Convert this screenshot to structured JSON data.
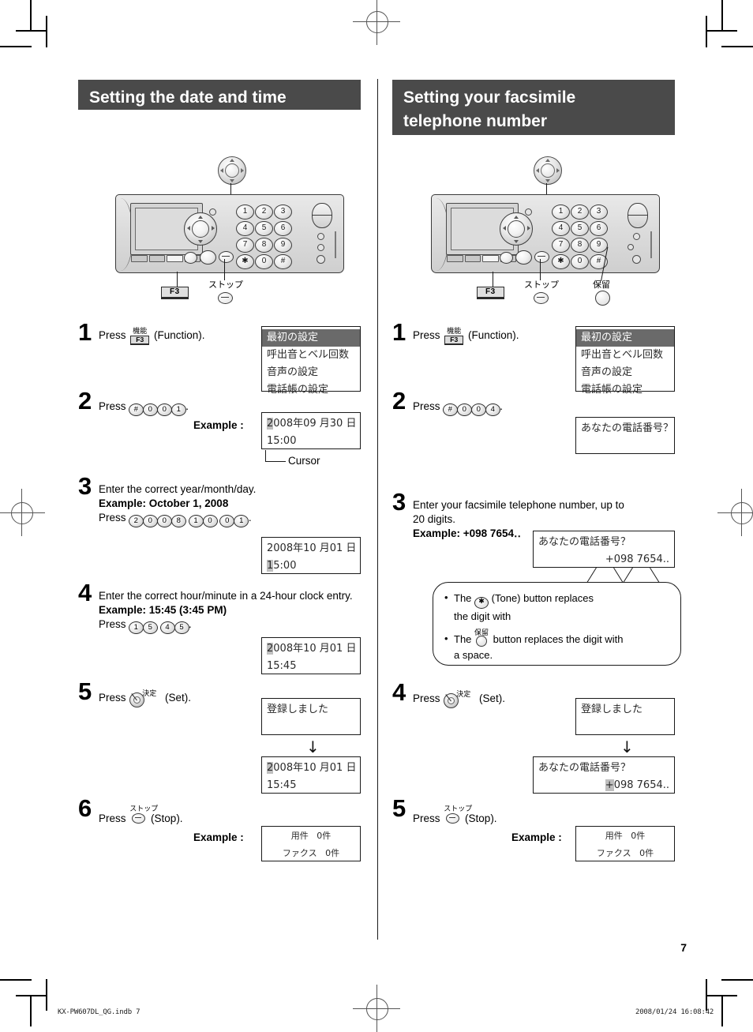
{
  "page_number": "7",
  "footer": {
    "left": "KX-PW607DL_QG.indb    7",
    "right": "2008/01/24    16:08:42"
  },
  "left_section": {
    "title": "Setting the date and time",
    "illustration": {
      "f3_label": "F3",
      "stop_label": "ストップ",
      "keys": [
        "1",
        "2",
        "3",
        "4",
        "5",
        "6",
        "7",
        "8",
        "9",
        "✱",
        "0",
        "#"
      ]
    },
    "steps": [
      {
        "num": "1",
        "press_prefix": "Press",
        "button_cap": "機能",
        "button_f3": "F3",
        "press_suffix": "(Function).",
        "lcd": {
          "selected": "最初の設定",
          "rows": [
            "呼出音とベル回数",
            "音声の設定",
            "電話帳の設定"
          ]
        }
      },
      {
        "num": "2",
        "press_prefix": "Press",
        "keys": [
          "#",
          "0",
          "0",
          "1"
        ],
        "press_suffix": ".",
        "example_label": "Example :",
        "lcd": {
          "cursor_char": "2",
          "line1_rest": "008年09 月30 日",
          "line2": "15:00"
        },
        "cursor_label": "Cursor"
      },
      {
        "num": "3",
        "line1": "Enter the correct year/month/day.",
        "line2": "Example: October 1, 2008",
        "press_prefix": "Press",
        "key_groups": [
          [
            "2",
            "0",
            "0",
            "8"
          ],
          [
            "1",
            "0"
          ],
          [
            "0",
            "1"
          ]
        ],
        "press_suffix": ".",
        "lcd": {
          "line1": "2008年10 月01 日",
          "cursor_char": "1",
          "line2_rest": "5:00"
        }
      },
      {
        "num": "4",
        "line1": "Enter the correct hour/minute in a 24-hour clock entry.",
        "line2": "Example: 15:45 (3:45 PM)",
        "press_prefix": "Press",
        "key_groups": [
          [
            "1",
            "5"
          ],
          [
            "4",
            "5"
          ]
        ],
        "press_suffix": ".",
        "lcd": {
          "cursor_char": "2",
          "line1_rest": "008年10 月01 日",
          "line2": "15:45"
        }
      },
      {
        "num": "5",
        "press_prefix": "Press",
        "button_cap": "決定",
        "press_suffix": "(Set).",
        "lcd1": {
          "line1": "登録しました"
        },
        "arrow": "↓",
        "lcd2": {
          "cursor_char": "2",
          "line1_rest": "008年10 月01 日",
          "line2": "15:45"
        }
      },
      {
        "num": "6",
        "press_prefix": "Press",
        "button_cap": "ストップ",
        "press_suffix": "(Stop).",
        "example_label": "Example :",
        "lcd": {
          "line1_label": "用件",
          "line1_val": "0件",
          "line2_label": "ファクス",
          "line2_val": "0件"
        }
      }
    ]
  },
  "right_section": {
    "title_line1": "Setting your facsimile",
    "title_line2": "telephone number",
    "illustration": {
      "f3_label": "F3",
      "stop_label": "ストップ",
      "hold_label": "保留",
      "keys": [
        "1",
        "2",
        "3",
        "4",
        "5",
        "6",
        "7",
        "8",
        "9",
        "✱",
        "0",
        "#"
      ]
    },
    "steps": [
      {
        "num": "1",
        "press_prefix": "Press",
        "button_cap": "機能",
        "button_f3": "F3",
        "press_suffix": "(Function).",
        "lcd": {
          "selected": "最初の設定",
          "rows": [
            "呼出音とベル回数",
            "音声の設定",
            "電話帳の設定"
          ]
        }
      },
      {
        "num": "2",
        "press_prefix": "Press",
        "keys": [
          "#",
          "0",
          "0",
          "4"
        ],
        "press_suffix": ".",
        "lcd": {
          "line1": "あなたの電話番号？"
        }
      },
      {
        "num": "3",
        "line1": "Enter your facsimile telephone number, up to",
        "line2": "20 digits.",
        "line3": "Example: +098 7654‥",
        "lcd": {
          "line1": "あなたの電話番号？",
          "line2": "+098  7654.."
        },
        "bubble": {
          "item1_pre": "The",
          "item1_icon": "✱",
          "item1_post": "(Tone) button replaces",
          "item1_line2": "the digit with",
          "item2_pre": "The",
          "item2_cap": "保留",
          "item2_post": "button replaces the digit with",
          "item2_line2": "a space."
        }
      },
      {
        "num": "4",
        "press_prefix": "Press",
        "button_cap": "決定",
        "press_suffix": "(Set).",
        "lcd1": {
          "line1": "登録しました"
        },
        "arrow": "↓",
        "lcd2": {
          "line1": "あなたの電話番号？",
          "cursor_char": "+",
          "line2_rest": "098  7654.."
        }
      },
      {
        "num": "5",
        "press_prefix": "Press",
        "button_cap": "ストップ",
        "press_suffix": "(Stop).",
        "example_label": "Example :",
        "lcd": {
          "line1_label": "用件",
          "line1_val": "0件",
          "line2_label": "ファクス",
          "line2_val": "0件"
        }
      }
    ]
  }
}
